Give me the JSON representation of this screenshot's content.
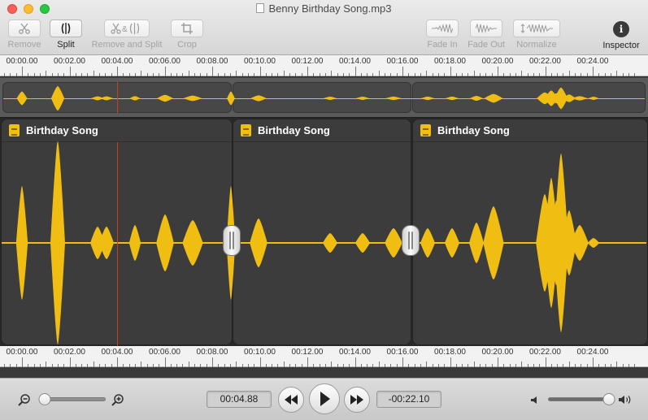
{
  "window": {
    "title": "Benny Birthday Song.mp3"
  },
  "toolbar": {
    "remove": "Remove",
    "split": "Split",
    "remove_and_split": "Remove and Split",
    "crop": "Crop",
    "fade_in": "Fade In",
    "fade_out": "Fade Out",
    "normalize": "Normalize",
    "inspector": "Inspector"
  },
  "ruler_labels": [
    "00:00.00",
    "00:02.00",
    "00:04.00",
    "00:06.00",
    "00:08.00",
    "00:10.00",
    "00:12.00",
    "00:14.00",
    "00:16.00",
    "00:18.00",
    "00:20.00",
    "00:22.00",
    "00:24.00"
  ],
  "clips": [
    {
      "title": "Birthday Song",
      "icon": "audio-file-icon"
    },
    {
      "title": "Birthday Song",
      "icon": "audio-file-icon"
    },
    {
      "title": "Birthday Song",
      "icon": "audio-file-icon"
    }
  ],
  "transport": {
    "elapsed": "00:04.88",
    "remaining": "-00:22.10",
    "zoom_level": 0.0,
    "volume_level": 1.0
  },
  "colors": {
    "waveform": "#f0be12",
    "playhead": "#d23a1e",
    "clip_bg": "#3c3c3c"
  }
}
